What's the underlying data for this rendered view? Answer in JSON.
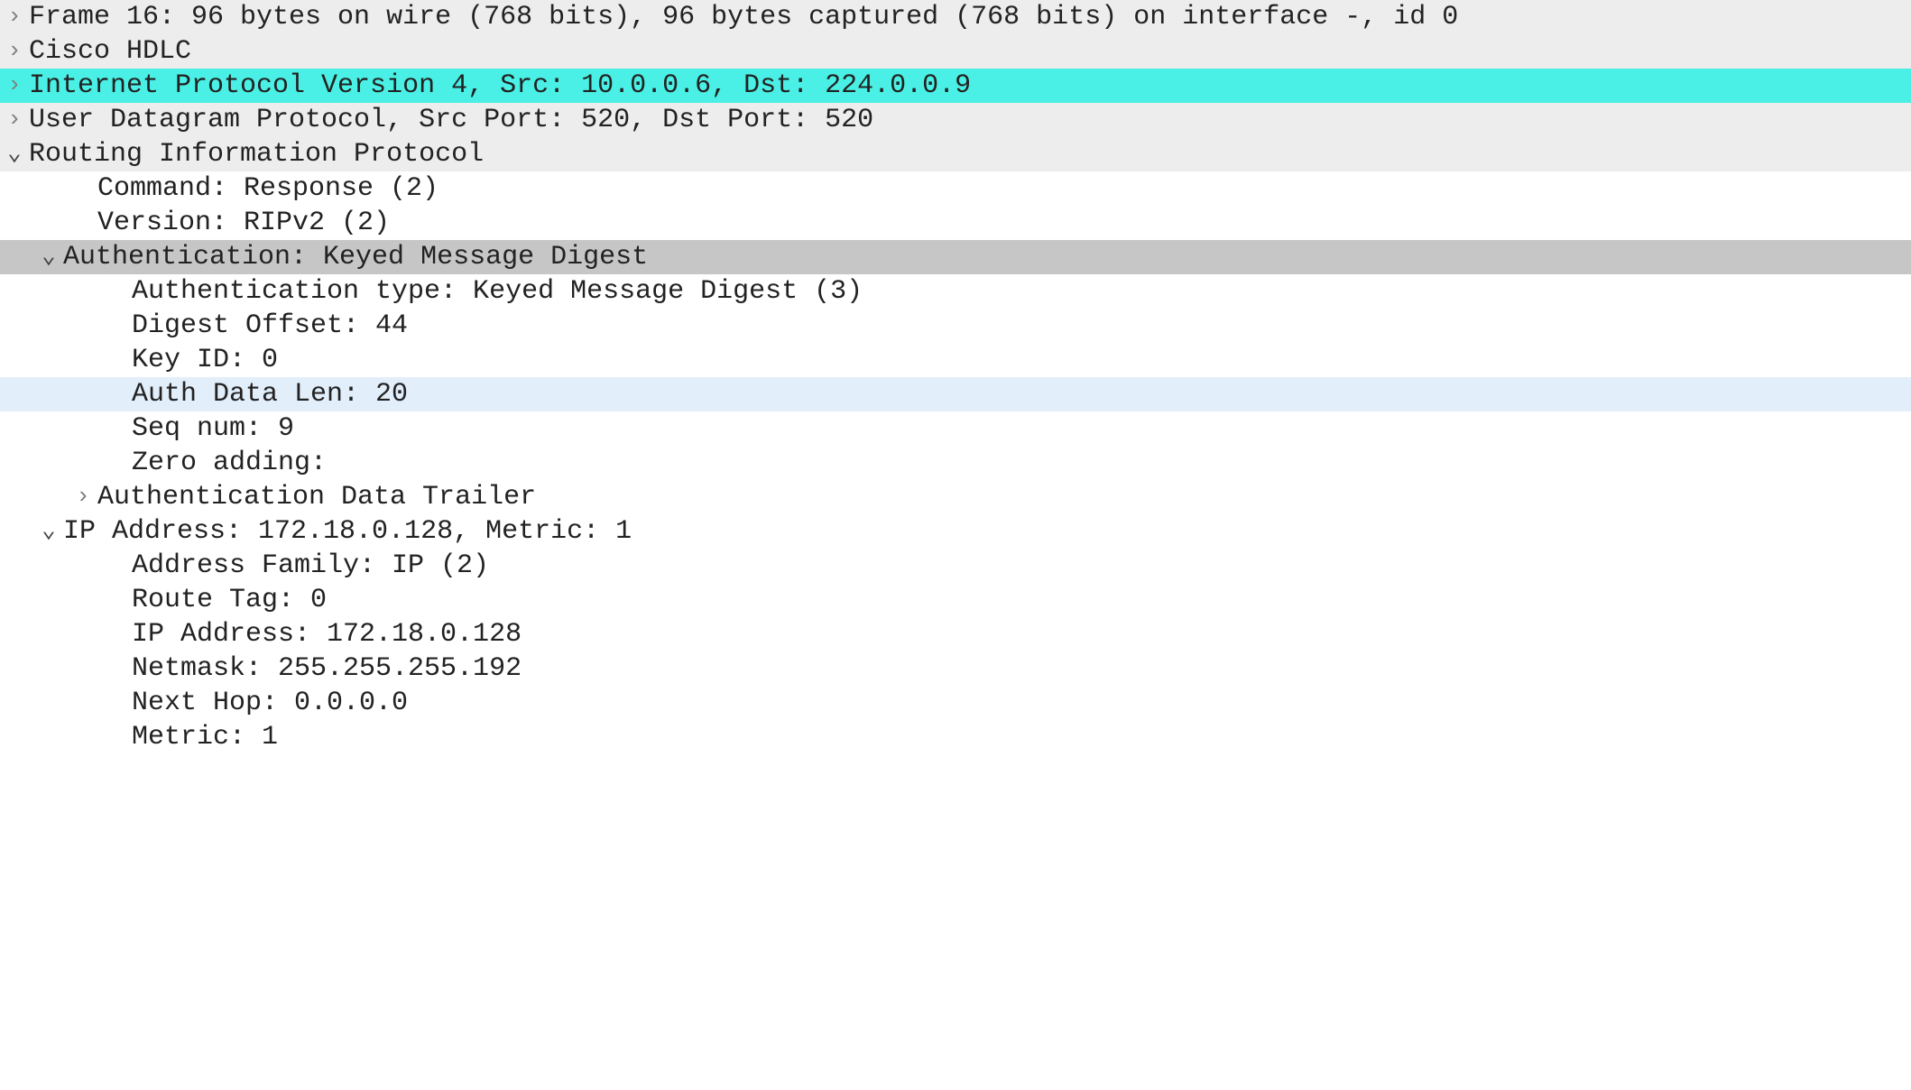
{
  "glyphs": {
    "collapsed": "›",
    "expanded": "⌄"
  },
  "rows": [
    {
      "indent": 0,
      "toggle": "collapsed",
      "bg": "bg-gray",
      "text": "Frame 16: 96 bytes on wire (768 bits), 96 bytes captured (768 bits) on interface -, id 0"
    },
    {
      "indent": 0,
      "toggle": "collapsed",
      "bg": "bg-gray",
      "text": "Cisco HDLC"
    },
    {
      "indent": 0,
      "toggle": "collapsed",
      "bg": "bg-cyan",
      "text": "Internet Protocol Version 4, Src: 10.0.0.6, Dst: 224.0.0.9"
    },
    {
      "indent": 0,
      "toggle": "collapsed",
      "bg": "bg-gray",
      "text": "User Datagram Protocol, Src Port: 520, Dst Port: 520"
    },
    {
      "indent": 0,
      "toggle": "expanded",
      "bg": "bg-gray",
      "text": "Routing Information Protocol"
    },
    {
      "indent": 1,
      "toggle": "none",
      "bg": "",
      "text": "Command: Response (2)"
    },
    {
      "indent": 1,
      "toggle": "none",
      "bg": "",
      "text": "Version: RIPv2 (2)"
    },
    {
      "indent": 1,
      "toggle": "expanded",
      "bg": "bg-sel",
      "text": "Authentication: Keyed Message Digest"
    },
    {
      "indent": 2,
      "toggle": "none",
      "bg": "",
      "text": "Authentication type: Keyed Message Digest (3)"
    },
    {
      "indent": 2,
      "toggle": "none",
      "bg": "",
      "text": "Digest Offset: 44"
    },
    {
      "indent": 2,
      "toggle": "none",
      "bg": "",
      "text": "Key ID: 0"
    },
    {
      "indent": 2,
      "toggle": "none",
      "bg": "bg-blue",
      "text": "Auth Data Len: 20"
    },
    {
      "indent": 2,
      "toggle": "none",
      "bg": "",
      "text": "Seq num: 9"
    },
    {
      "indent": 2,
      "toggle": "none",
      "bg": "",
      "text": "Zero adding:"
    },
    {
      "indent": 2,
      "toggle": "collapsed",
      "bg": "",
      "text": "Authentication Data Trailer"
    },
    {
      "indent": 1,
      "toggle": "expanded",
      "bg": "",
      "text": "IP Address: 172.18.0.128, Metric: 1"
    },
    {
      "indent": 2,
      "toggle": "none",
      "bg": "",
      "text": "Address Family: IP (2)"
    },
    {
      "indent": 2,
      "toggle": "none",
      "bg": "",
      "text": "Route Tag: 0"
    },
    {
      "indent": 2,
      "toggle": "none",
      "bg": "",
      "text": "IP Address: 172.18.0.128"
    },
    {
      "indent": 2,
      "toggle": "none",
      "bg": "",
      "text": "Netmask: 255.255.255.192"
    },
    {
      "indent": 2,
      "toggle": "none",
      "bg": "",
      "text": "Next Hop: 0.0.0.0"
    },
    {
      "indent": 2,
      "toggle": "none",
      "bg": "",
      "text": "Metric: 1"
    }
  ]
}
